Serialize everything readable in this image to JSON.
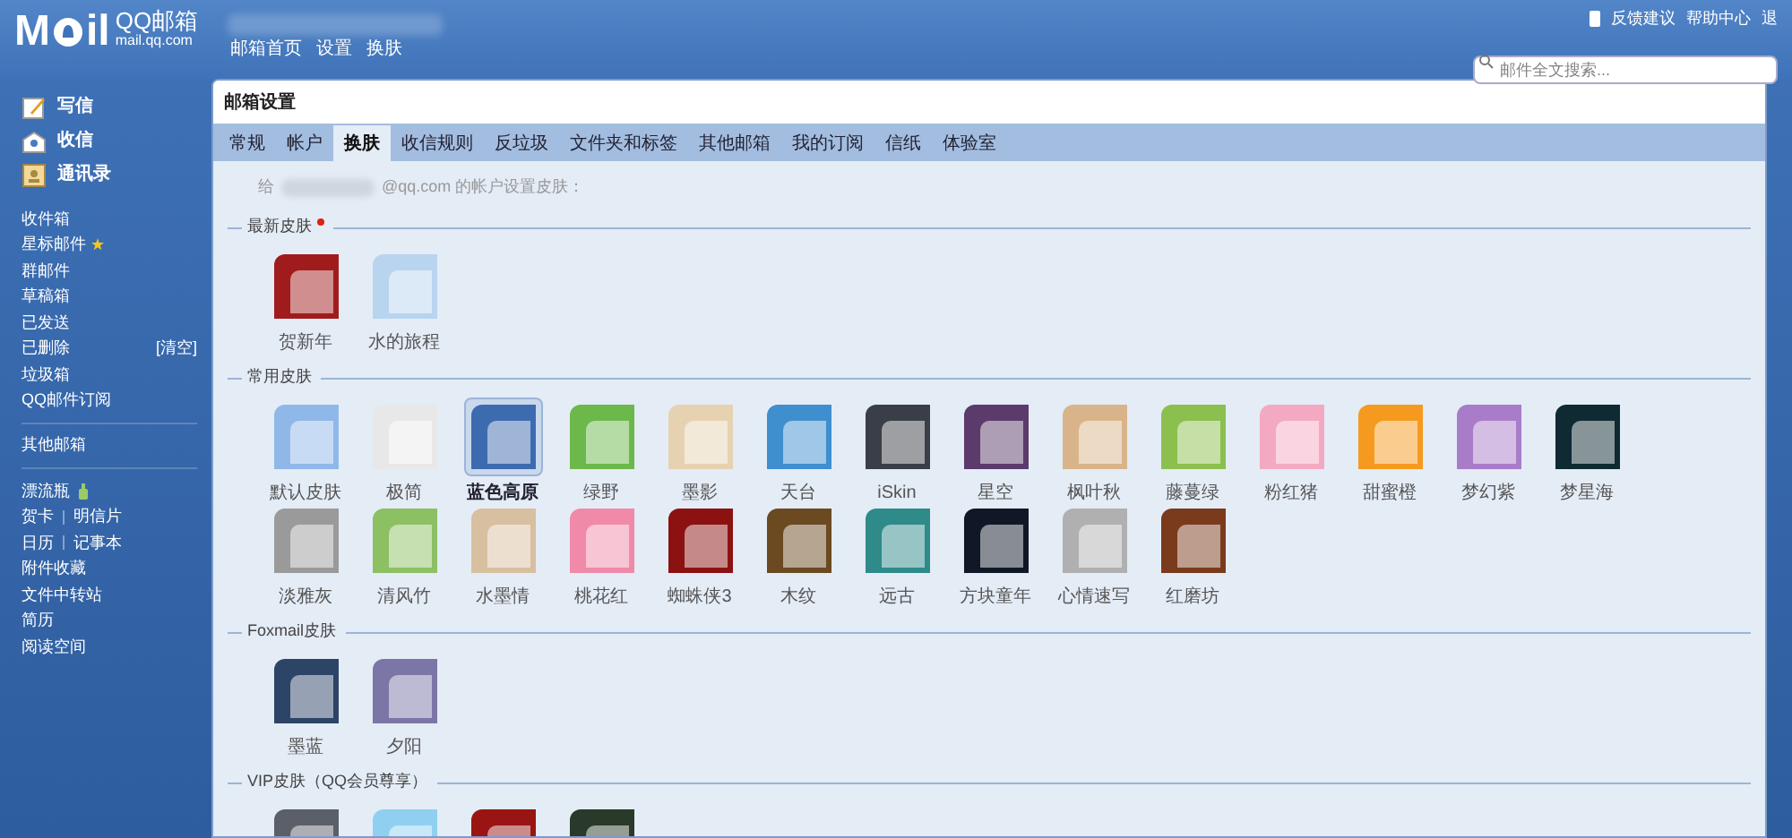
{
  "header": {
    "logo_left": "M",
    "logo_right": "il",
    "brand": "QQ邮箱",
    "domain": "mail.qq.com",
    "nav": [
      "邮箱首页",
      "设置",
      "换肤"
    ],
    "top_links": [
      "反馈建议",
      "帮助中心",
      "退"
    ],
    "search": {
      "placeholder": "邮件全文搜索..."
    }
  },
  "sidebar": {
    "actions": [
      {
        "label": "写信",
        "kind": "write"
      },
      {
        "label": "收信",
        "kind": "inbox"
      },
      {
        "label": "通讯录",
        "kind": "contacts"
      }
    ],
    "folders": [
      {
        "label": "收件箱"
      },
      {
        "label": "星标邮件",
        "kind": "star"
      },
      {
        "label": "群邮件"
      },
      {
        "label": "草稿箱"
      },
      {
        "label": "已发送"
      },
      {
        "label": "已删除",
        "extra": "[清空]"
      },
      {
        "label": "垃圾箱"
      },
      {
        "label": "QQ邮件订阅"
      }
    ],
    "other": [
      "其他邮箱"
    ],
    "tools": [
      {
        "items": [
          "漂流瓶"
        ],
        "kind": "bottle"
      },
      {
        "items": [
          "贺卡",
          "明信片"
        ]
      },
      {
        "items": [
          "日历",
          "记事本"
        ]
      },
      {
        "items": [
          "附件收藏"
        ]
      },
      {
        "items": [
          "文件中转站"
        ]
      },
      {
        "items": [
          "简历"
        ]
      },
      {
        "items": [
          "阅读空间"
        ]
      }
    ]
  },
  "panel": {
    "title": "邮箱设置",
    "tabs": [
      {
        "label": "常规",
        "selected": false
      },
      {
        "label": "帐户",
        "selected": false
      },
      {
        "label": "换肤",
        "selected": true
      },
      {
        "label": "收信规则",
        "selected": false
      },
      {
        "label": "反垃圾",
        "selected": false
      },
      {
        "label": "文件夹和标签",
        "selected": false
      },
      {
        "label": "其他邮箱",
        "selected": false
      },
      {
        "label": "我的订阅",
        "selected": false
      },
      {
        "label": "信纸",
        "selected": false
      },
      {
        "label": "体验室",
        "selected": false
      }
    ],
    "account_prefix": "给",
    "account_suffix": "@qq.com 的帐户设置皮肤：",
    "sections": [
      {
        "title": "最新皮肤",
        "new": true,
        "skins": [
          {
            "label": "贺新年",
            "color": "#a01c1c",
            "selected": false
          },
          {
            "label": "水的旅程",
            "color": "#b8d4ef",
            "selected": false
          }
        ]
      },
      {
        "title": "常用皮肤",
        "new": false,
        "skins": [
          {
            "label": "默认皮肤",
            "color": "#8fb8e8",
            "selected": false
          },
          {
            "label": "极简",
            "color": "#e8e8e8",
            "selected": false
          },
          {
            "label": "蓝色高原",
            "color": "#3d6bb0",
            "selected": true
          },
          {
            "label": "绿野",
            "color": "#6cb84a",
            "selected": false
          },
          {
            "label": "墨影",
            "color": "#e6d2b0",
            "selected": false
          },
          {
            "label": "天台",
            "color": "#3f8fcf",
            "selected": false
          },
          {
            "label": "iSkin",
            "color": "#3a3f47",
            "selected": false
          },
          {
            "label": "星空",
            "color": "#5b3b6b",
            "selected": false
          },
          {
            "label": "枫叶秋",
            "color": "#d9b48a",
            "selected": false
          },
          {
            "label": "藤蔓绿",
            "color": "#8bbf4e",
            "selected": false
          },
          {
            "label": "粉红猪",
            "color": "#f4a9c2",
            "selected": false
          },
          {
            "label": "甜蜜橙",
            "color": "#f59a1e",
            "selected": false
          },
          {
            "label": "梦幻紫",
            "color": "#a97cc9",
            "selected": false
          },
          {
            "label": "梦星海",
            "color": "#0f2a33",
            "selected": false
          },
          {
            "label": "淡雅灰",
            "color": "#9a9a9a",
            "selected": false
          },
          {
            "label": "清风竹",
            "color": "#8cc063",
            "selected": false
          },
          {
            "label": "水墨情",
            "color": "#d8bfa0",
            "selected": false
          },
          {
            "label": "桃花红",
            "color": "#f08aa8",
            "selected": false
          },
          {
            "label": "蜘蛛侠3",
            "color": "#8c1212",
            "selected": false
          },
          {
            "label": "木纹",
            "color": "#6b4a22",
            "selected": false
          },
          {
            "label": "远古",
            "color": "#2f8a8a",
            "selected": false
          },
          {
            "label": "方块童年",
            "color": "#101828",
            "selected": false
          },
          {
            "label": "心情速写",
            "color": "#b0b0b0",
            "selected": false
          },
          {
            "label": "红磨坊",
            "color": "#7a3b1c",
            "selected": false
          }
        ]
      },
      {
        "title": "Foxmail皮肤",
        "new": false,
        "skins": [
          {
            "label": "墨蓝",
            "color": "#2c4566",
            "selected": false
          },
          {
            "label": "夕阳",
            "color": "#7b76a6",
            "selected": false
          }
        ]
      },
      {
        "title": "VIP皮肤（QQ会员尊享）",
        "new": false,
        "skins": [
          {
            "color": "#5a5f68",
            "selected": false
          },
          {
            "color": "#8fd0f0",
            "selected": false
          },
          {
            "color": "#9a1414",
            "selected": false
          },
          {
            "color": "#2a3a2a",
            "selected": false
          }
        ]
      }
    ]
  }
}
